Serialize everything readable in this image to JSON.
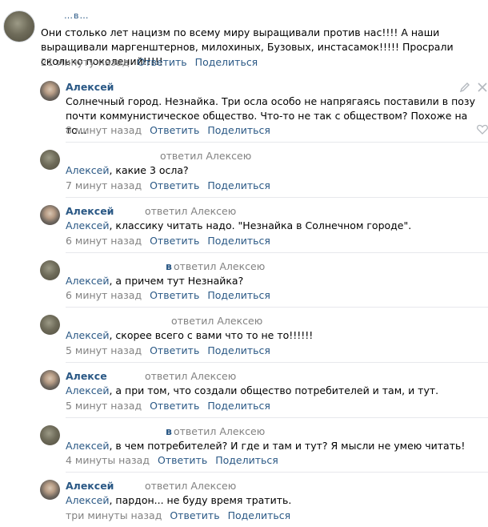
{
  "root": {
    "author": "…в…",
    "text": "Они столько лет нацизм по всему миру выращивали против нас!!!! А наши выращивали маргенштернов, милохиных, Бузовых, инстасамок!!!!! Просрали сколько поколений!!!!!",
    "time": "21 минуту назад",
    "reply": "Ответить",
    "share": "Поделиться"
  },
  "replies": [
    {
      "author": "Алексей",
      "replied_to": "",
      "addressee": "",
      "text": "Солнечный город. Незнайка. Три осла особо не напрягаясь поставили в позу почти коммунистическое общество. Что-то не так с обществом? Похоже на то...",
      "time": "8 минут назад",
      "reply": "Ответить",
      "share": "Поделиться"
    },
    {
      "author": "",
      "replied_to": "ответил Алексею",
      "addressee": "Алексей",
      "text": ", какие 3 осла?",
      "time": "7 минут назад",
      "reply": "Ответить",
      "share": "Поделиться"
    },
    {
      "author": "Алексей",
      "replied_to": "ответил Алексею",
      "addressee": "Алексей",
      "text": ", классику читать надо. \"Незнайка в Солнечном городе\".",
      "time": "6 минут назад",
      "reply": "Ответить",
      "share": "Поделиться"
    },
    {
      "author": "в",
      "replied_to": "ответил Алексею",
      "addressee": "Алексей",
      "text": ", а причем тут Незнайка?",
      "time": "6 минут назад",
      "reply": "Ответить",
      "share": "Поделиться"
    },
    {
      "author": "",
      "replied_to": "ответил Алексею",
      "addressee": "Алексей",
      "text": ", скорее всего с вами что то не то!!!!!!",
      "time": "5 минут назад",
      "reply": "Ответить",
      "share": "Поделиться"
    },
    {
      "author": "Алексе",
      "replied_to": "ответил Алексею",
      "addressee": "Алексей",
      "text": ", а при том, что создали общество потребителей и там, и тут.",
      "time": "5 минут назад",
      "reply": "Ответить",
      "share": "Поделиться"
    },
    {
      "author": "в",
      "replied_to": "ответил Алексею",
      "addressee": "Алексей",
      "text": ", в чем потребителей? И где и там и тут? Я мысли не умею читать!",
      "time": "4 минуты назад",
      "reply": "Ответить",
      "share": "Поделиться"
    },
    {
      "author": "Алексей",
      "replied_to": "ответил Алексею",
      "addressee": "Алексей",
      "text": ", пардон... не буду время тратить.",
      "time": "три минуты назад",
      "reply": "Ответить",
      "share": "Поделиться"
    }
  ],
  "icons": {
    "edit": "pencil-icon",
    "close": "close-icon",
    "like": "heart-icon"
  },
  "colors": {
    "link": "#2a5885",
    "meta": "#828282",
    "separator": "#e7e8ec"
  }
}
